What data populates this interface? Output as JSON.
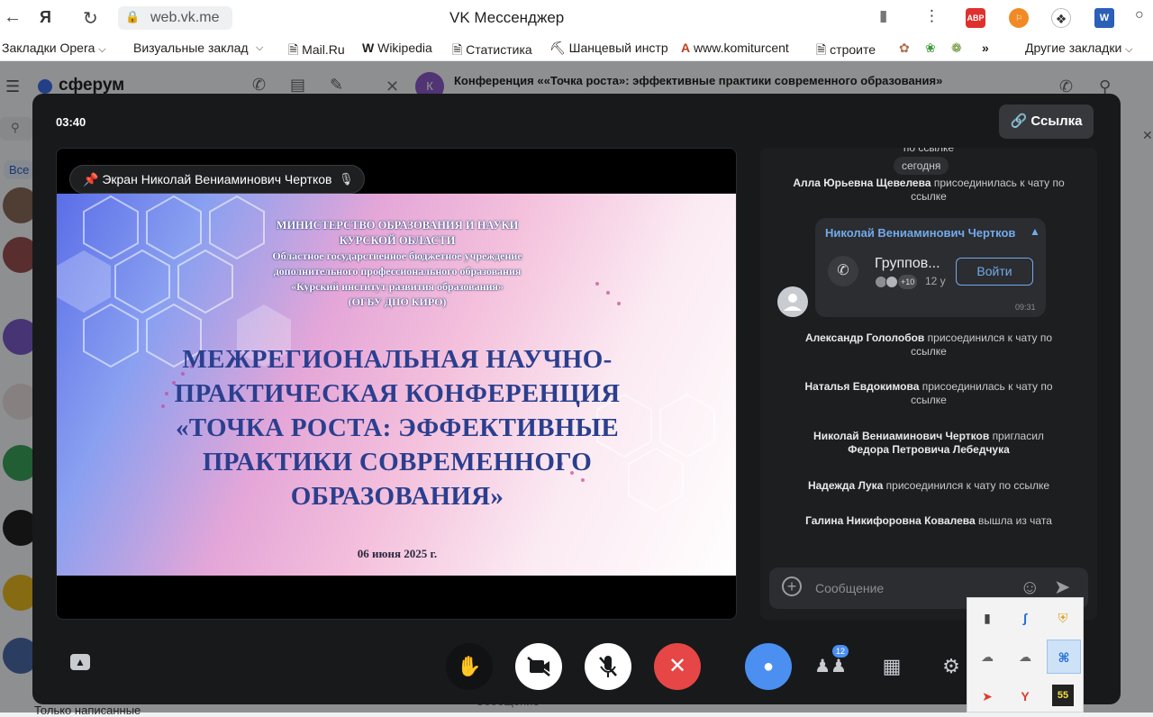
{
  "browser": {
    "url": "web.vk.me",
    "title": "VK Мессенджер",
    "ext_abp": "ABP"
  },
  "bookmarks": {
    "items": [
      "Закладки Opera",
      "Визуальные заклад",
      "Mail.Ru",
      "Wikipedia",
      "Статистика",
      "Шанцевый инстр",
      "www.komiturcent",
      "строите",
      "Другие закладки"
    ],
    "more": "»"
  },
  "background": {
    "app_name": "сферум",
    "search_tab": "Все",
    "conversation_title": "Конференция ««Точка роста»: эффективные практики современного образования»",
    "bottom_text": "Только написанные",
    "bottom_input": "Сообщение"
  },
  "call": {
    "timer": "03:40",
    "link_button": "Ссылка",
    "screen_label": "Экран Николай Вениаминович Чертков",
    "participants_badge": "12"
  },
  "slide": {
    "org_lines": [
      "МИНИСТЕРСТВО ОБРАЗОВАНИЯ И НАУКИ",
      "КУРСКОЙ ОБЛАСТИ",
      "Областное государственное бюджетное учреждение",
      "дополнительного профессионального образования",
      "«Курский институт развития образования»",
      "(ОГБУ ДПО КИРО)"
    ],
    "title_lines": [
      "МЕЖРЕГИОНАЛЬНАЯ НАУЧНО-",
      "ПРАКТИЧЕСКАЯ КОНФЕРЕНЦИЯ",
      "«ТОЧКА РОСТА: ЭФФЕКТИВНЫЕ",
      "ПРАКТИКИ СОВРЕМЕННОГО",
      "ОБРАЗОВАНИЯ»"
    ],
    "date": "06 июня 2025 г."
  },
  "chat": {
    "partial_top": "по ссылке",
    "date_chip": "сегодня",
    "events": [
      {
        "name": "Алла Юрьевна Щевелева",
        "text": "присоединилась к чату по ссылке"
      },
      {
        "name": "Александр Гололобов",
        "text": "присоединился к чату по ссылке"
      },
      {
        "name": "Наталья Евдокимова",
        "text": "присоединилась к чату по ссылке"
      },
      {
        "name": "Николай Вениаминович Чертков",
        "text": "пригласил",
        "name2": "Федора Петровича Лебедчука"
      },
      {
        "name": "Надежда Лука",
        "text": "присоединился к чату по ссылке"
      },
      {
        "name": "Галина Никифоровна Ковалева",
        "text": "вышла из чата"
      }
    ],
    "bubble": {
      "author": "Николай Вениаминович Чертков",
      "call_title": "Группов...",
      "join_button": "Войти",
      "plus_count": "+10",
      "participants": "12 у",
      "time": "09:31"
    },
    "input_placeholder": "Сообщение"
  },
  "colors": {
    "modal_bg": "#18191b",
    "end_call": "#e64646",
    "chat_button": "#4b8ff0",
    "accent_link": "#71aaeb"
  }
}
